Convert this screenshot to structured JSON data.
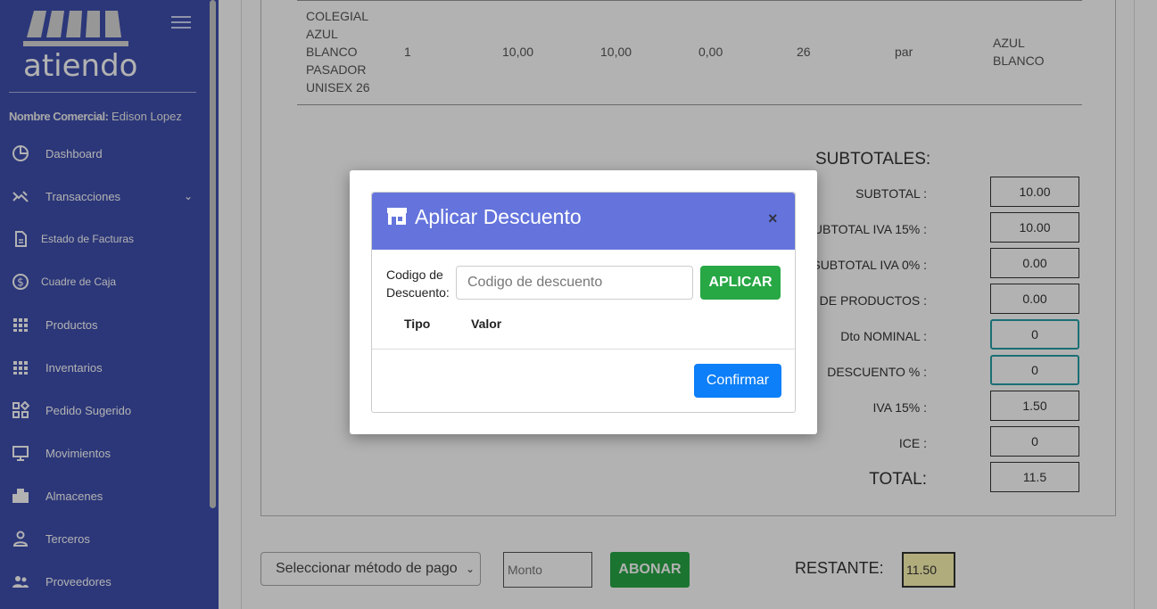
{
  "brand": {
    "logo_text": "atiendo"
  },
  "sidebar": {
    "commercial_label": "Nombre Comercial:",
    "commercial_value": "Edison Lopez",
    "items": [
      {
        "label": "Dashboard",
        "icon": "pie-chart-icon"
      },
      {
        "label": "Transacciones",
        "icon": "transactions-icon"
      },
      {
        "label": "Estado de Facturas",
        "icon": "document-icon"
      },
      {
        "label": "Cuadre de Caja",
        "icon": "dollar-circle-icon"
      },
      {
        "label": "Productos",
        "icon": "grid-icon"
      },
      {
        "label": "Inventarios",
        "icon": "grid-icon"
      },
      {
        "label": "Pedido Sugerido",
        "icon": "widgets-icon"
      },
      {
        "label": "Movimientos",
        "icon": "monitor-icon"
      },
      {
        "label": "Almacenes",
        "icon": "building-icon"
      },
      {
        "label": "Terceros",
        "icon": "person-icon"
      },
      {
        "label": "Proveedores",
        "icon": "people-icon"
      }
    ]
  },
  "product_row": {
    "name_lines": [
      "COLEGIAL",
      "AZUL",
      "BLANCO",
      "PASADOR",
      "UNISEX 26"
    ],
    "qty": "1",
    "price": "10,00",
    "subtotal": "10,00",
    "discount": "0,00",
    "size": "26",
    "unit": "par",
    "color_lines": [
      "AZUL",
      "BLANCO"
    ]
  },
  "subtotals": {
    "title": "SUBTOTALES:",
    "rows": [
      {
        "label": "SUBTOTAL :",
        "value": "10.00"
      },
      {
        "label": "SUBTOTAL IVA 15% :",
        "value": "10.00"
      },
      {
        "label": "SUBTOTAL IVA 0% :",
        "value": "0.00"
      },
      {
        "label": "Dto DE PRODUCTOS :",
        "value": "0.00"
      },
      {
        "label": "Dto NOMINAL :",
        "value": "0"
      },
      {
        "label": "DESCUENTO % :",
        "value": "0"
      },
      {
        "label": "IVA 15% :",
        "value": "1.50"
      },
      {
        "label": "ICE :",
        "value": "0"
      }
    ],
    "total_label": "TOTAL:",
    "total_value": "11.5"
  },
  "payment": {
    "method_selected": "Seleccionar método de pago",
    "amount_placeholder": "Monto",
    "abonar_label": "ABONAR",
    "restante_label": "RESTANTE:",
    "restante_value": "11.50"
  },
  "modal": {
    "title": "Aplicar Descuento",
    "close": "×",
    "code_label_1": "Codigo de",
    "code_label_2": "Descuento:",
    "code_placeholder": "Codigo de descuento",
    "apply_label": "APLICAR",
    "col_tipo": "Tipo",
    "col_valor": "Valor",
    "confirm_label": "Confirmar"
  },
  "colors": {
    "sidebar_bg": "#3f4fae",
    "modal_header": "#6474dc",
    "success": "#28a745",
    "primary": "#0d7ff8",
    "teal_border": "#26a0a8"
  }
}
